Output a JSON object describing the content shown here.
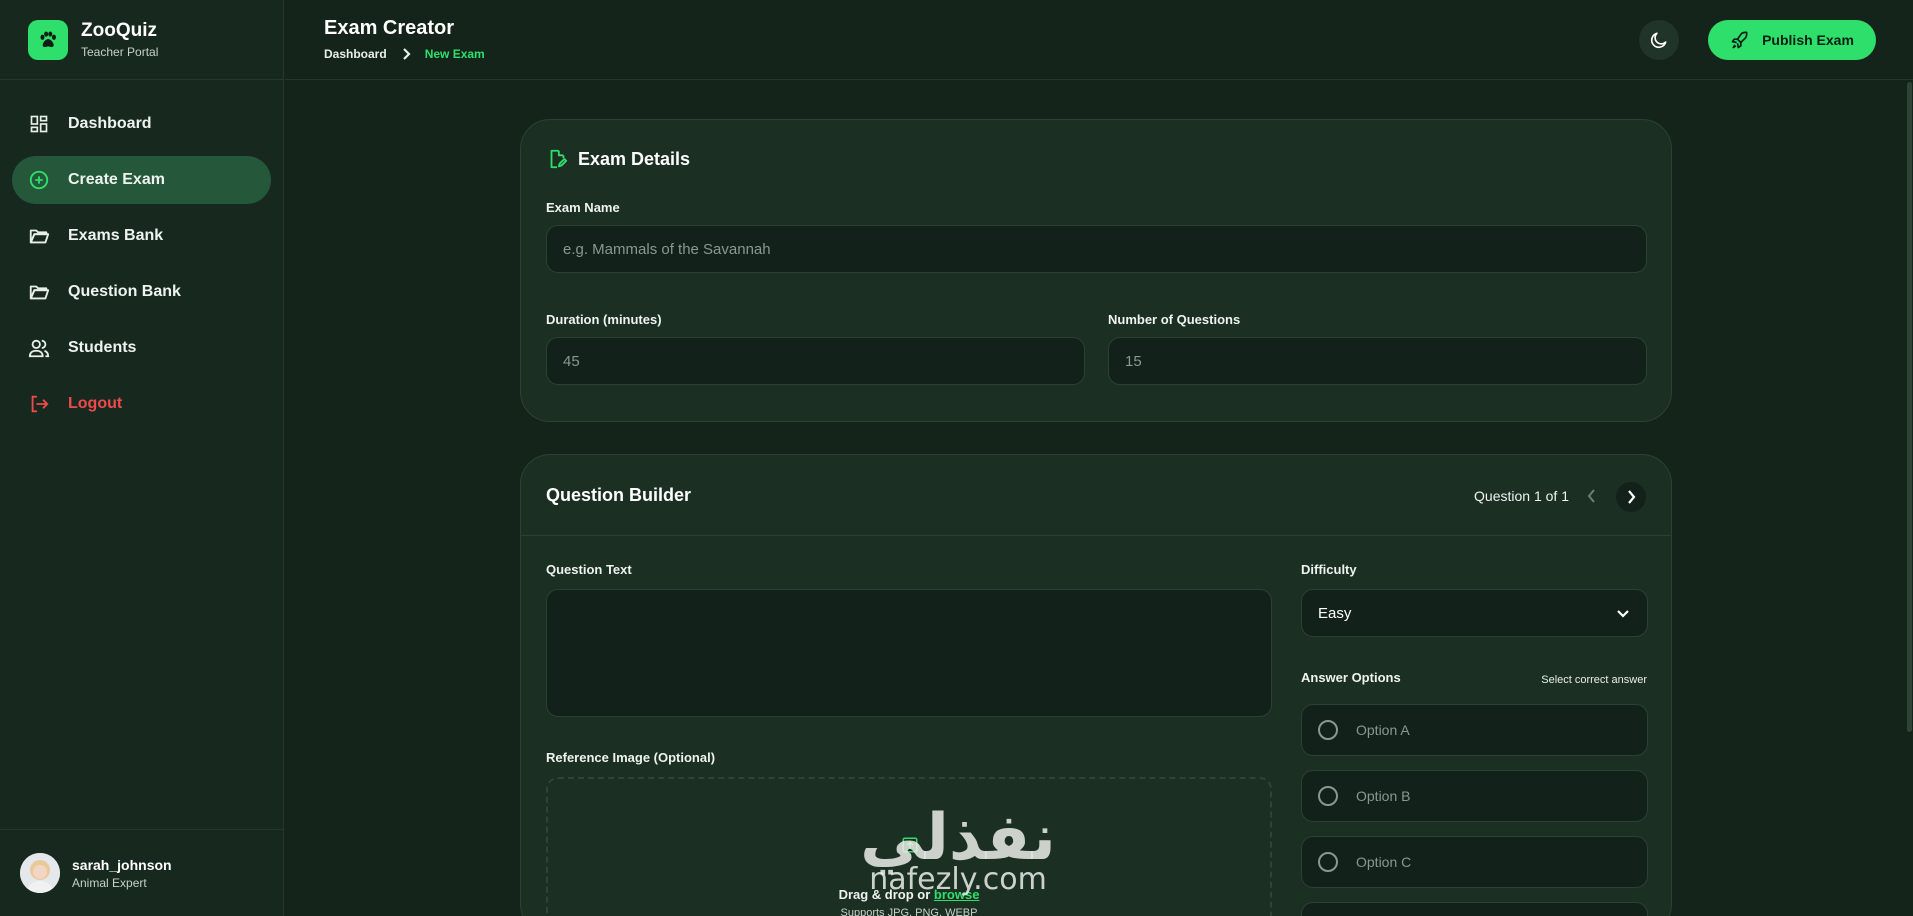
{
  "brand": {
    "title": "ZooQuiz",
    "subtitle": "Teacher Portal",
    "icon": "paw-icon",
    "accent": "#2ee06b"
  },
  "sidebar": {
    "items": [
      {
        "label": "Dashboard",
        "icon": "dashboard-icon"
      },
      {
        "label": "Create Exam",
        "icon": "plus-circle-icon",
        "active": true
      },
      {
        "label": "Exams Bank",
        "icon": "folder-icon"
      },
      {
        "label": "Question Bank",
        "icon": "folder-icon"
      },
      {
        "label": "Students",
        "icon": "users-icon"
      },
      {
        "label": "Logout",
        "icon": "logout-icon",
        "color": "#ef4a4a"
      }
    ],
    "user": {
      "name": "sarah_johnson",
      "role": "Animal Expert"
    }
  },
  "header": {
    "title": "Exam Creator",
    "breadcrumb": {
      "home": "Dashboard",
      "current": "New Exam"
    },
    "publish_label": "Publish Exam",
    "theme_icon": "moon-icon"
  },
  "exam_details": {
    "title": "Exam Details",
    "name_label": "Exam Name",
    "name_placeholder": "e.g. Mammals of the Savannah",
    "duration_label": "Duration (minutes)",
    "duration_placeholder": "45",
    "questions_label": "Number of Questions",
    "questions_placeholder": "15"
  },
  "question_builder": {
    "title": "Question Builder",
    "counter": "Question 1 of 1",
    "question_text_label": "Question Text",
    "difficulty_label": "Difficulty",
    "difficulty_value": "Easy",
    "answer_options_label": "Answer Options",
    "answer_hint": "Select correct answer",
    "options": [
      "Option A",
      "Option B",
      "Option C"
    ],
    "image_label": "Reference Image (Optional)",
    "dropzone_text": "Drag & drop or ",
    "dropzone_link": "browse",
    "dropzone_sub": "Supports JPG, PNG, WEBP"
  },
  "watermark": {
    "arabic": "نفذلي",
    "latin": "nafezly.com"
  }
}
